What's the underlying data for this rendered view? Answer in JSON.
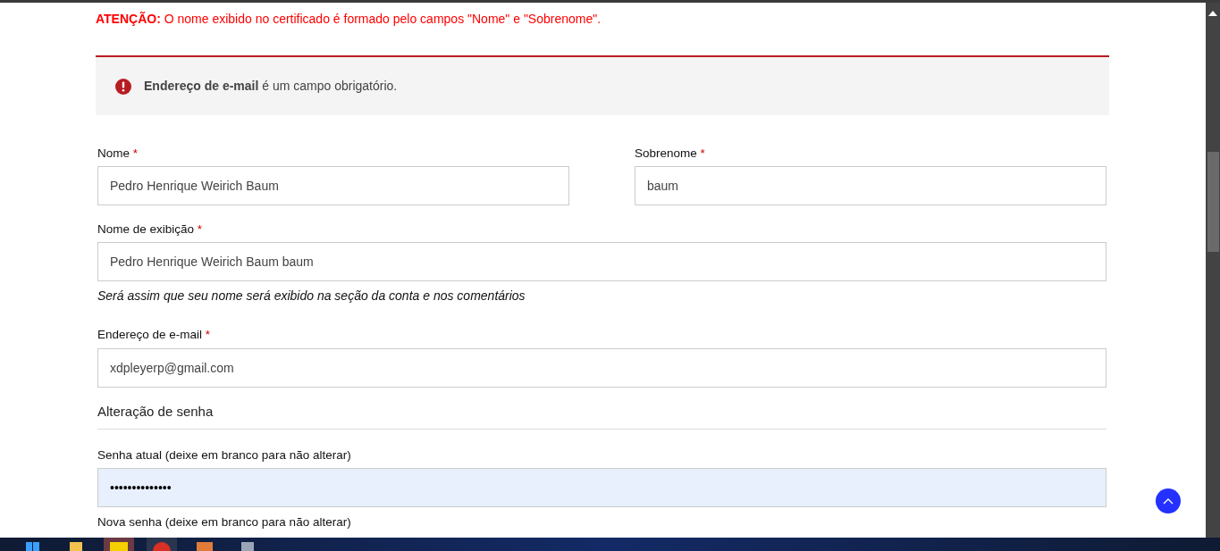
{
  "notice": {
    "label": "ATENÇÃO:",
    "text": "O nome exibido no certificado é formado pelo campos \"Nome\" e \"Sobrenome\"."
  },
  "error": {
    "text": "**Endereço de e-mail** é um campo obrigatório."
  },
  "fields": [
    {
      "kind": "half",
      "label": "Nome",
      "required_mark": "*",
      "value": "Pedro Henrique Weirich Baum"
    },
    {
      "kind": "half",
      "label": "Sobrenome",
      "required_mark": "*",
      "value": "baum"
    },
    {
      "kind": "full",
      "label": "Nome de exibição",
      "required_mark": "*",
      "value": "Pedro Henrique Weirich Baum baum",
      "help": "Será assim que seu nome será exibido na seção da conta e nos comentários"
    },
    {
      "kind": "full",
      "label": "Endereço de e-mail",
      "required_mark": "*",
      "value": "xdpleyerp@gmail.com"
    },
    {
      "kind": "heading",
      "label": "Alteração de senha"
    },
    {
      "kind": "password",
      "label": "Senha atual (deixe em branco para não alterar)",
      "value": "••••••••••••••",
      "autofilled": true
    },
    {
      "kind": "label",
      "label": "Nova senha (deixe em branco para não alterar)"
    }
  ]
}
